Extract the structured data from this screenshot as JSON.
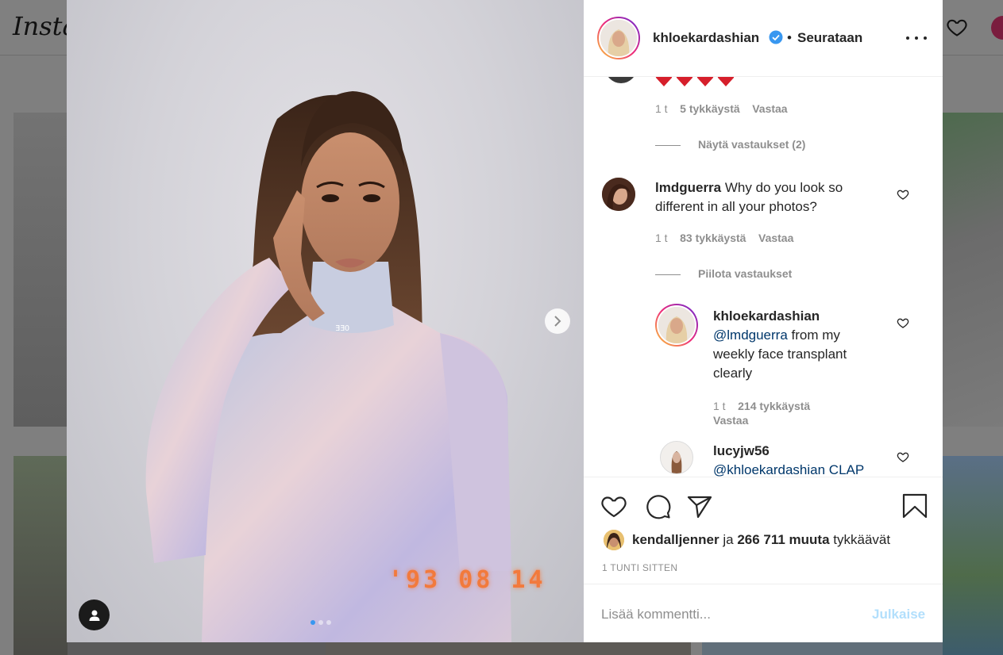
{
  "background": {
    "logo_text": "Insta"
  },
  "post": {
    "datestamp": "'93 08 14",
    "carousel": {
      "slides": 3,
      "active": 1
    }
  },
  "header": {
    "username": "khloekardashian",
    "separator": "•",
    "follow_status": "Seurataan"
  },
  "comments": {
    "first": {
      "time": "1 t",
      "likes": "5 tykkäystä",
      "reply": "Vastaa",
      "toggle": "Näytä vastaukset (2)"
    },
    "second": {
      "username": "lmdguerra",
      "text": "Why do you look so different in all your photos?",
      "time": "1 t",
      "likes": "83 tykkäystä",
      "reply": "Vastaa",
      "toggle": "Piilota vastaukset"
    },
    "reply1": {
      "username": "khloekardashian",
      "mention": "@lmdguerra",
      "text": "from my weekly face transplant clearly",
      "time": "1 t",
      "likes": "214 tykkäystä",
      "reply": "Vastaa"
    },
    "reply2": {
      "username": "lucyjw56",
      "text_partial": "@khloekardashian CLAP"
    }
  },
  "likes": {
    "first_liker": "kendalljenner",
    "conj": "ja",
    "others": "266 711 muuta",
    "suffix": "tykkäävät"
  },
  "timestamp": "1 TUNTI SITTEN",
  "comment_box": {
    "placeholder": "Lisää kommentti...",
    "post_label": "Julkaise"
  },
  "colors": {
    "verified": "#3897f0",
    "post_button_disabled": "#b2dffc",
    "story_ring": [
      "#f9ce34",
      "#ee2a7b",
      "#6228d7"
    ],
    "datestamp": "#f27a3c"
  }
}
